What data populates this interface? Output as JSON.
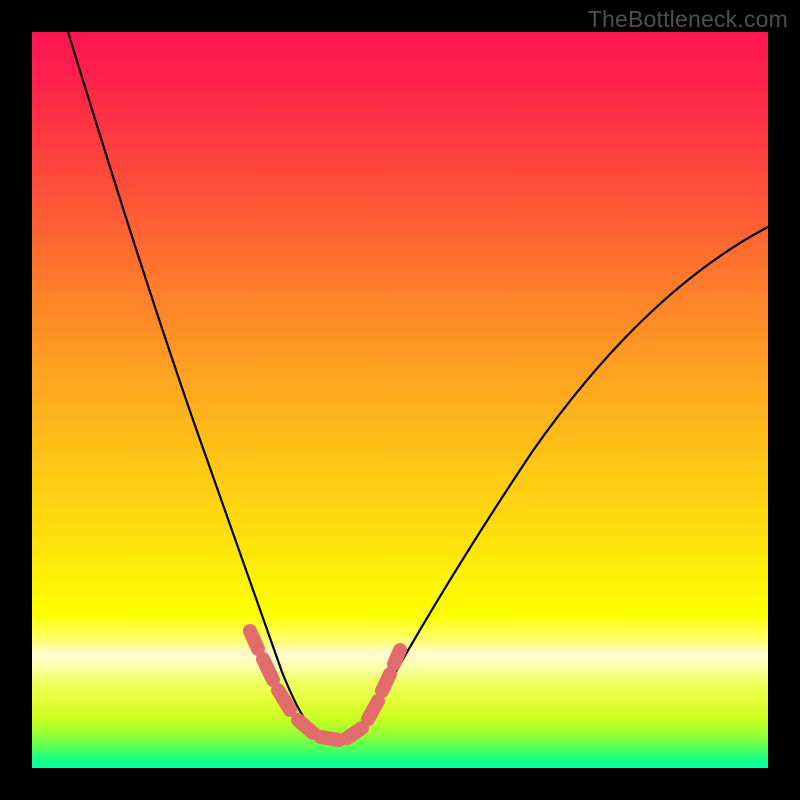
{
  "watermark": "TheBottleneck.com",
  "chart_data": {
    "type": "line",
    "title": "",
    "xlabel": "",
    "ylabel": "",
    "xlim": [
      0,
      1
    ],
    "ylim": [
      0,
      1
    ],
    "note": "Axes are unlabeled; x and y are normalized 0–1 within the plot area. y=1 at top, y=0 at bottom.",
    "series": [
      {
        "name": "main-curve",
        "x": [
          0.05,
          0.1,
          0.15,
          0.2,
          0.25,
          0.3,
          0.34,
          0.37,
          0.4,
          0.43,
          0.46,
          0.5,
          0.56,
          0.63,
          0.72,
          0.82,
          0.92,
          1.0
        ],
        "y": [
          1.0,
          0.83,
          0.67,
          0.52,
          0.38,
          0.24,
          0.12,
          0.06,
          0.035,
          0.035,
          0.05,
          0.1,
          0.2,
          0.32,
          0.45,
          0.57,
          0.67,
          0.73
        ]
      },
      {
        "name": "highlight-marks",
        "x": [
          0.3,
          0.315,
          0.33,
          0.35,
          0.37,
          0.39,
          0.41,
          0.43,
          0.447,
          0.46,
          0.472,
          0.487,
          0.496
        ],
        "y": [
          0.19,
          0.16,
          0.125,
          0.09,
          0.06,
          0.042,
          0.035,
          0.035,
          0.043,
          0.055,
          0.08,
          0.115,
          0.155
        ]
      }
    ],
    "colors": {
      "curve": "#000000",
      "highlight": "#e26b6b",
      "background_top": "#fe1550",
      "background_bottom": "#00ff99"
    }
  }
}
